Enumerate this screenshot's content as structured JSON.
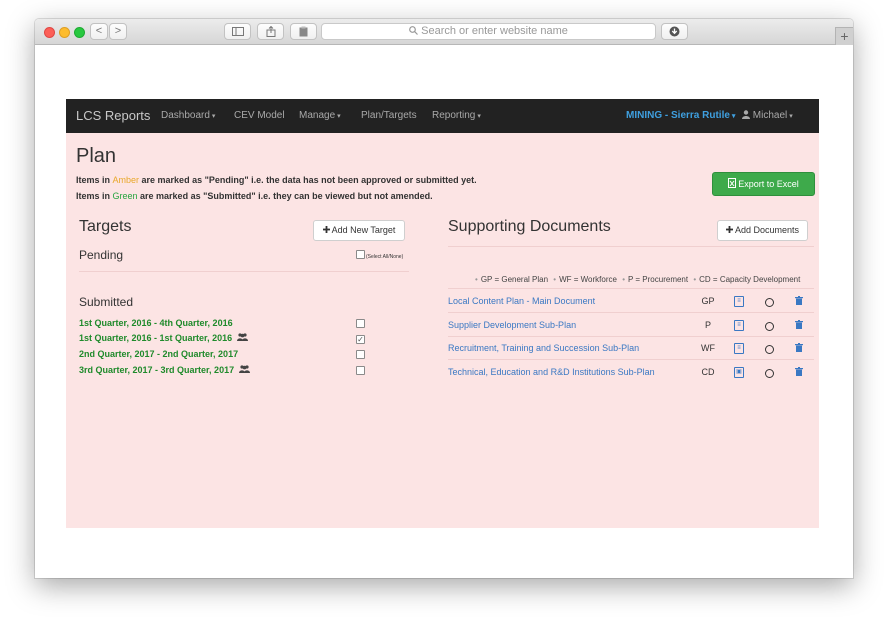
{
  "browser": {
    "url_placeholder": "Search or enter website name",
    "back_glyph": "<",
    "forward_glyph": ">",
    "plus_glyph": "+"
  },
  "navbar": {
    "brand": "LCS Reports",
    "items": [
      {
        "label": "Dashboard",
        "dropdown": true
      },
      {
        "label": "CEV Model",
        "dropdown": false
      },
      {
        "label": "Manage",
        "dropdown": true
      },
      {
        "label": "Plan/Targets",
        "dropdown": false
      },
      {
        "label": "Reporting",
        "dropdown": true
      }
    ],
    "organization": "MINING - Sierra Rutile",
    "user": "Michael",
    "caret": "▾"
  },
  "page": {
    "title": "Plan",
    "note_amber_prefix": "Items in ",
    "note_amber_word": "Amber",
    "note_amber_suffix": " are marked as \"Pending\" i.e. the data has not been approved or submitted yet.",
    "note_green_prefix": "Items in ",
    "note_green_word": "Green",
    "note_green_suffix": " are marked as \"Submitted\" i.e. they can be viewed but not amended.",
    "export_label": "Export to Excel"
  },
  "targets": {
    "title": "Targets",
    "add_label": "Add New Target",
    "pending_title": "Pending",
    "select_all_label": "(Select All/None)",
    "submitted_title": "Submitted",
    "submitted_items": [
      {
        "label": "1st Quarter, 2016 - 4th Quarter, 2016",
        "users_icon": false,
        "checked": false
      },
      {
        "label": "1st Quarter, 2016 - 1st Quarter, 2016",
        "users_icon": true,
        "checked": true
      },
      {
        "label": "2nd Quarter, 2017 - 2nd Quarter, 2017",
        "users_icon": false,
        "checked": false
      },
      {
        "label": "3rd Quarter, 2017 - 3rd Quarter, 2017",
        "users_icon": true,
        "checked": false
      }
    ]
  },
  "documents": {
    "title": "Supporting Documents",
    "add_label": "Add Documents",
    "legend": [
      "GP = General Plan",
      "WF = Workforce",
      "P = Procurement",
      "CD = Capacity Development"
    ],
    "rows": [
      {
        "name": "Local Content Plan - Main Document",
        "code": "GP"
      },
      {
        "name": "Supplier Development Sub-Plan",
        "code": "P"
      },
      {
        "name": "Recruitment, Training and Succession Sub-Plan",
        "code": "WF"
      },
      {
        "name": "Technical, Education and R&D Institutions Sub-Plan",
        "code": "CD"
      }
    ]
  },
  "colors": {
    "page_background": "#fce4e4",
    "navbar": "#222222",
    "amber": "#e9a82b",
    "green": "#27a43f",
    "export_button": "#3eaa4b",
    "link": "#3a78c3"
  }
}
